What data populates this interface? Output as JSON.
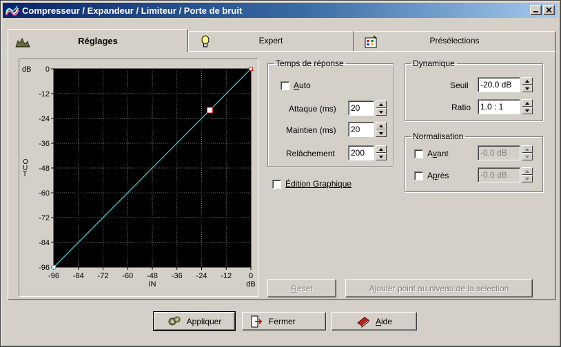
{
  "window": {
    "title": "Compresseur / Expandeur / Limiteur / Porte de bruit",
    "icon": "app-wave-icon"
  },
  "tabs": [
    {
      "label": "Réglages",
      "icon": "waveform-icon",
      "active": true
    },
    {
      "label": "Expert",
      "icon": "lightbulb-icon",
      "active": false
    },
    {
      "label": "Présélections",
      "icon": "presets-icon",
      "active": false
    }
  ],
  "chart_data": {
    "type": "line",
    "ylabel_top": "dB",
    "ylabel_letters": [
      "O",
      "U",
      "T"
    ],
    "xlabel": "IN",
    "xlabel_unit": "dB",
    "xlim": [
      -96,
      0
    ],
    "ylim": [
      -96,
      0
    ],
    "x_ticks": [
      "-96",
      "-84",
      "-72",
      "-60",
      "-48",
      "-36",
      "-24",
      "-12",
      "0"
    ],
    "y_ticks": [
      "0",
      "-12",
      "-24",
      "-36",
      "-48",
      "-60",
      "-72",
      "-84",
      "-96"
    ],
    "grid": true,
    "line_color": "#3cc8d0",
    "background": "#000000",
    "series": [
      {
        "x": [
          -96,
          -20,
          0
        ],
        "y": [
          -96,
          -20,
          0
        ]
      }
    ]
  },
  "timing": {
    "legend": "Temps de réponse",
    "auto_label": "Auto",
    "auto_underline": "A",
    "auto_checked": false,
    "attack_label": "Attaque (ms)",
    "attack_value": "20",
    "hold_label": "Maintien (ms)",
    "hold_value": "20",
    "release_label": "Relâchement",
    "release_value": "200"
  },
  "graphic_edit": {
    "label": "Édition Graphique",
    "checked": false
  },
  "dynamics": {
    "legend": "Dynamique",
    "threshold_label": "Seuil",
    "threshold_value": "-20.0 dB",
    "ratio_label": "Ratio",
    "ratio_value": "1.0 : 1"
  },
  "normalization": {
    "legend": "Normalisation",
    "before_label_pre": "A",
    "before_label_u": "v",
    "before_label_post": "ant",
    "before_value": "-0.0 dB",
    "after_label_pre": "A",
    "after_label_u": "p",
    "after_label_post": "rès",
    "after_value": "-0.0 dB"
  },
  "panel_buttons": {
    "reset_u": "R",
    "reset_rest": "eset",
    "add_point": "Ajouter point au niveau de la selection"
  },
  "footer": {
    "apply_label": "Appliquer",
    "close_label": "Fermer",
    "help_u": "A",
    "help_rest": "ide"
  }
}
